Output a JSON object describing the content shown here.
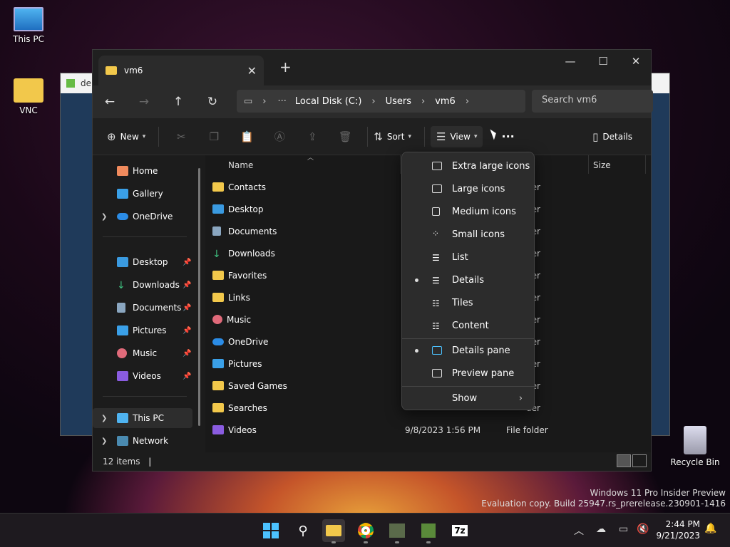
{
  "desktop": {
    "icons": [
      {
        "label": "This PC"
      },
      {
        "label": "VNC"
      },
      {
        "label": "Recycle Bin"
      }
    ]
  },
  "background_window": {
    "title": "de"
  },
  "explorer": {
    "tab_title": "vm6",
    "address": {
      "segments": [
        "Local Disk (C:)",
        "Users",
        "vm6"
      ]
    },
    "search_placeholder": "Search vm6",
    "commands": {
      "new": "New",
      "sort": "Sort",
      "view": "View",
      "details": "Details"
    },
    "nav": {
      "top": [
        "Home",
        "Gallery",
        "OneDrive"
      ],
      "quick": [
        "Desktop",
        "Downloads",
        "Documents",
        "Pictures",
        "Music",
        "Videos"
      ],
      "bottom": [
        "This PC",
        "Network"
      ]
    },
    "columns": {
      "name": "Name",
      "size": "Size"
    },
    "files": [
      {
        "name": "Contacts",
        "date": "",
        "type": "der"
      },
      {
        "name": "Desktop",
        "date": "",
        "type": "der"
      },
      {
        "name": "Documents",
        "date": "",
        "type": "der"
      },
      {
        "name": "Downloads",
        "date": "",
        "type": "der"
      },
      {
        "name": "Favorites",
        "date": "",
        "type": "der"
      },
      {
        "name": "Links",
        "date": "",
        "type": "der"
      },
      {
        "name": "Music",
        "date": "",
        "type": "der"
      },
      {
        "name": "OneDrive",
        "date": "",
        "type": "der"
      },
      {
        "name": "Pictures",
        "date": "",
        "type": "der"
      },
      {
        "name": "Saved Games",
        "date": "",
        "type": "der"
      },
      {
        "name": "Searches",
        "date": "",
        "type": "der"
      },
      {
        "name": "Videos",
        "date": "9/8/2023 1:56 PM",
        "type": "File folder"
      }
    ],
    "status": "12 items"
  },
  "view_menu": {
    "items": [
      {
        "label": "Extra large icons",
        "selected": false
      },
      {
        "label": "Large icons",
        "selected": false
      },
      {
        "label": "Medium icons",
        "selected": false
      },
      {
        "label": "Small icons",
        "selected": false
      },
      {
        "label": "List",
        "selected": false
      },
      {
        "label": "Details",
        "selected": true
      },
      {
        "label": "Tiles",
        "selected": false
      },
      {
        "label": "Content",
        "selected": false
      }
    ],
    "panes": [
      {
        "label": "Details pane",
        "selected": true
      },
      {
        "label": "Preview pane",
        "selected": false
      }
    ],
    "show": "Show"
  },
  "watermark": {
    "line1": "Windows 11 Pro Insider Preview",
    "line2": "Evaluation copy. Build 25947.rs_prerelease.230901-1416"
  },
  "taskbar": {
    "time": "2:44 PM",
    "date": "9/21/2023",
    "seven_zip_label": "7z"
  },
  "colors": {
    "folder": "#f2c84b",
    "accent": "#4cc2ff"
  }
}
